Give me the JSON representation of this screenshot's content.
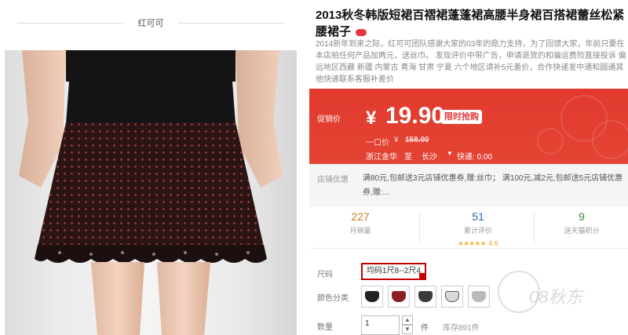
{
  "brand": {
    "name": "红可可"
  },
  "product": {
    "title": "2013秋冬韩版短裙百褶裙蓬蓬裙高腰半身裙百搭裙蕾丝松紧腰裙子",
    "promo_text": "2014新年到来之际，红可可团队感谢大家的03年的鼎力支持，为了回馈大家，年前只要在本店拍任何产品加两元，送丝巾。 发现评价中带广告，申请退货的和骗运费险直接投诉 偏远地区西藏 新疆 内蒙古 青海 甘肃 宁夏 六个地区请补5元差价，合作快递发中通和圆通其他快递联系客服补差价"
  },
  "price": {
    "label": "促销价",
    "currency": "¥",
    "value": "19.90",
    "badge": "限时抢购",
    "original_label": "一口价",
    "original_currency": "¥",
    "original_value": "158.00"
  },
  "shipping": {
    "origin": "浙江金华",
    "to": "至",
    "destination": "长沙",
    "fee": "快递: 0.00"
  },
  "coupon": {
    "label": "店铺优惠",
    "text": "满80元,包邮送3元店铺优惠券,赠:丝巾； 满100元,减2元,包邮送5元店铺优惠券,赠:..."
  },
  "stats": [
    {
      "value": "227",
      "label": "月销量",
      "color": "#c97a2a"
    },
    {
      "value": "51",
      "label": "累计评价",
      "color": "#2b6db5"
    },
    {
      "value": "9",
      "label": "送天猫积分",
      "color": "#3a8a3a"
    }
  ],
  "rating": {
    "stars": "★★★★★",
    "value": "4.6"
  },
  "options": {
    "size_label": "尺码",
    "size_value": "均码1尺8--2尺4",
    "color_label": "颜色分类",
    "swatches": [
      "#222222",
      "#8a1f24",
      "#3a3a3a",
      "#d8d8d8",
      "#b9b9b9"
    ],
    "qty_label": "数量",
    "qty_value": "1",
    "qty_unit": "件",
    "stock": "库存891件"
  },
  "watermark": "08秋东",
  "colors": {
    "accent": "#e4393c",
    "price_bg": "#e23a2e"
  }
}
